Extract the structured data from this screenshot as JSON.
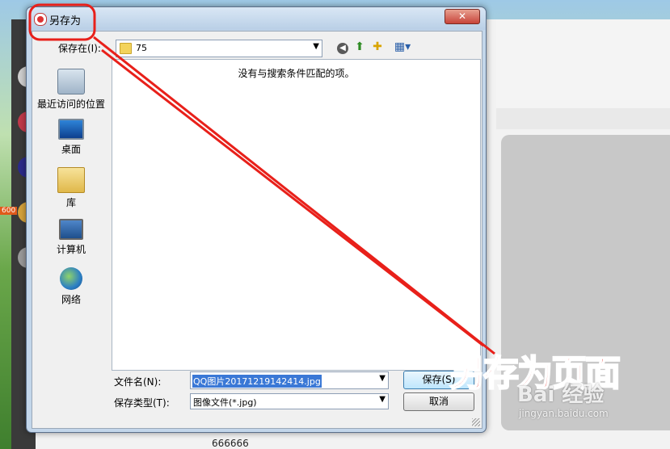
{
  "dialog": {
    "title": "另存为",
    "close_glyph": "✕"
  },
  "toolbar": {
    "save_in_label": "保存在(I):",
    "save_in_value": "75",
    "back_glyph": "◀",
    "up_glyph": "⬆",
    "new_folder_glyph": "✚",
    "views_glyph": "▦▾"
  },
  "places": [
    {
      "label": "最近访问的位置",
      "icon": "recent-places-icon"
    },
    {
      "label": "桌面",
      "icon": "desktop-icon"
    },
    {
      "label": "库",
      "icon": "library-icon"
    },
    {
      "label": "计算机",
      "icon": "computer-icon"
    },
    {
      "label": "网络",
      "icon": "network-icon"
    }
  ],
  "file_list": {
    "empty_message": "没有与搜索条件匹配的项。"
  },
  "fields": {
    "filename_label": "文件名(N):",
    "filename_value": "QQ图片20171219142414.jpg",
    "filetype_label": "保存类型(T):",
    "filetype_value": "图像文件(*.jpg)"
  },
  "buttons": {
    "save": "保存(S)",
    "cancel": "取消"
  },
  "annotation": {
    "text": "另存为页面",
    "color": "#e8201a"
  },
  "background": {
    "bottom_text": "666666",
    "badge": "600"
  },
  "watermark": {
    "logo": "Bai 经验",
    "url": "jingyan.baidu.com"
  }
}
